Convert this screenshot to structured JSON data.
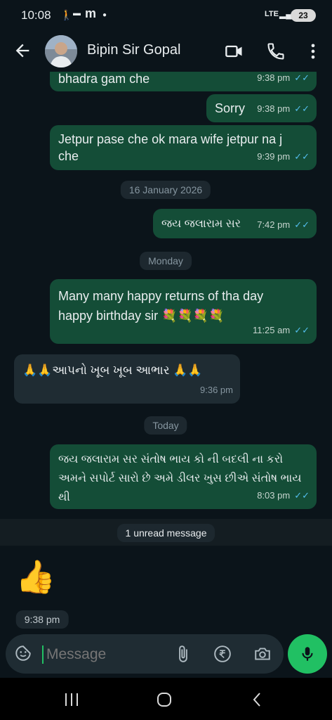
{
  "status_bar": {
    "time": "10:08",
    "network": "LTE",
    "battery": "23"
  },
  "header": {
    "contact_name": "Bipin Sir Gopal"
  },
  "messages": [
    {
      "text": "bhadra gam che",
      "time": "9:38 pm"
    },
    {
      "text": "Sorry",
      "time": "9:38 pm"
    },
    {
      "text": "Jetpur pase che ok mara wife jetpur na j che",
      "time": "9:39 pm"
    },
    {
      "text": "જય જલારામ સર",
      "time": "7:42 pm"
    },
    {
      "text": "Many many happy returns of tha day happy birthday sir 💐💐💐💐",
      "time": "11:25 am"
    },
    {
      "text": "🙏🙏આપનો ખૂબ ખૂબ આભાર 🙏🙏",
      "time": "9:36 pm"
    },
    {
      "text": "જય જલારામ સર સંતોષ ભાય કો ની બદલી ના કરો અમને સપોર્ટ સારો છે અમે ડીલર ખુસ છીએ સંતોષ ભાય થી",
      "time": "8:03 pm"
    },
    {
      "text": "👍",
      "time": "9:38 pm"
    }
  ],
  "date_separators": {
    "d1": "16 January 2026",
    "d2": "Monday",
    "d3": "Today"
  },
  "unread_banner": "1 unread message",
  "composer": {
    "placeholder": "Message"
  },
  "icons": {
    "back": "arrow-left-icon",
    "video": "video-camera-icon",
    "call": "phone-icon",
    "menu": "more-vert-icon",
    "emoji": "sticker-icon",
    "attach": "paperclip-icon",
    "payment": "rupee-icon",
    "camera": "camera-icon",
    "mic": "mic-icon"
  },
  "colors": {
    "outgoing_bubble": "#144d37",
    "incoming_bubble": "#1f2c33",
    "accent": "#21c063",
    "tick": "#53bdeb"
  }
}
